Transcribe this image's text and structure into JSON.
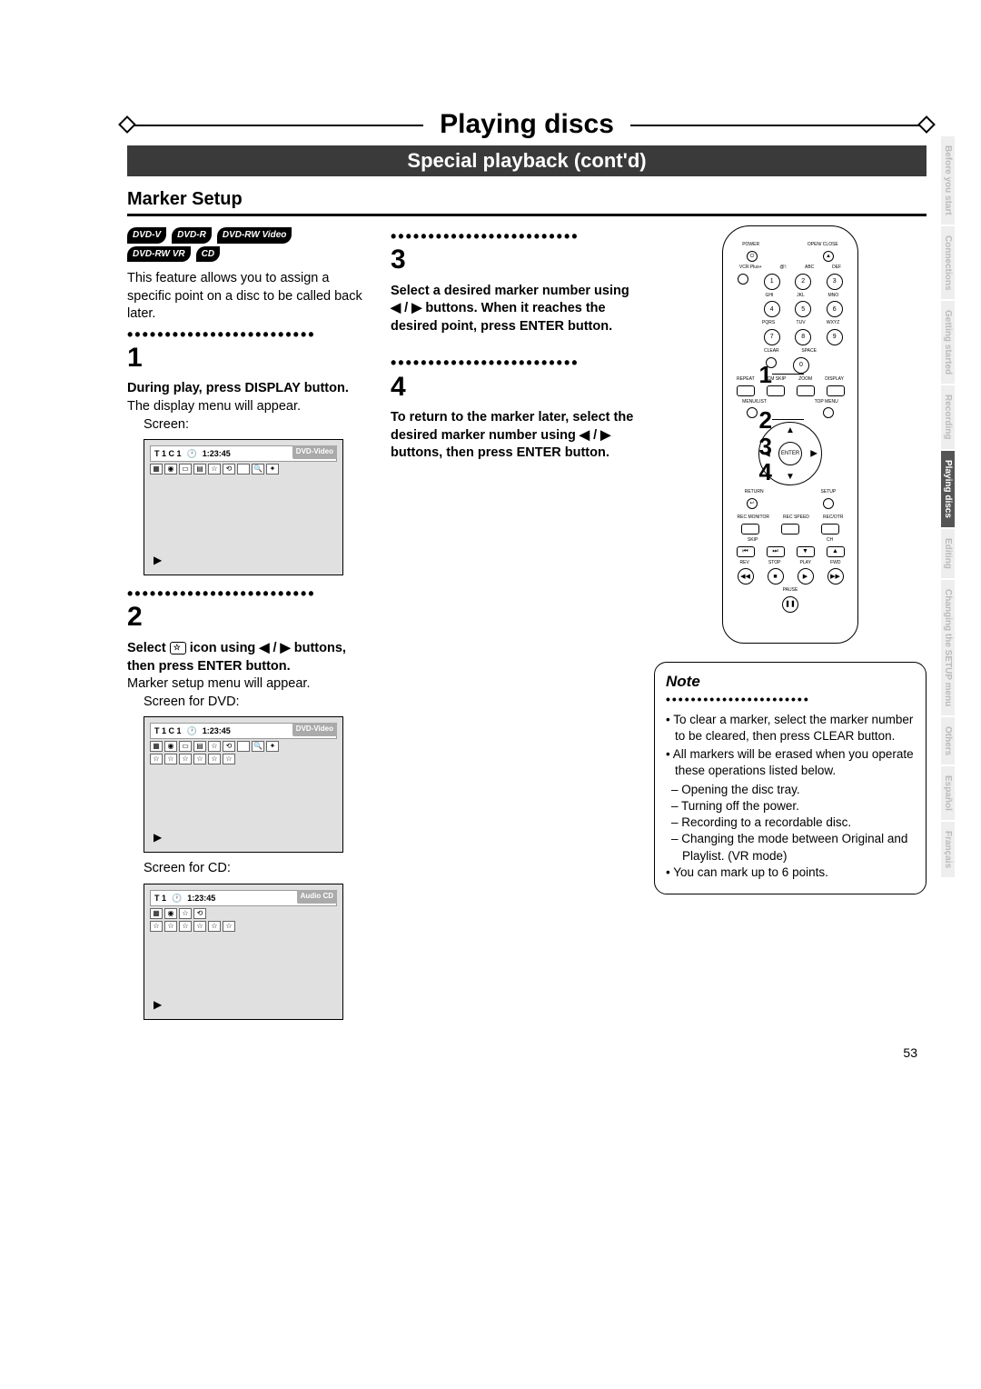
{
  "page_title": "Playing discs",
  "subtitle": "Special playback (cont'd)",
  "section_heading": "Marker Setup",
  "disc_badges": [
    "DVD-V",
    "DVD-R",
    "DVD-RW Video",
    "DVD-RW VR",
    "CD"
  ],
  "intro": "This feature allows you to assign a specific point on a disc to be called back later.",
  "step1": {
    "num": "1",
    "bold": "During play, press DISPLAY button.",
    "text": "The display menu will appear.",
    "screen_label": "Screen:",
    "screen_time": "1:23:45",
    "screen_info": "T   1  C   1",
    "disc_type": "DVD-Video"
  },
  "step2": {
    "num": "2",
    "bold_pre": "Select ",
    "bold_mid": " icon using ",
    "arrows": "◀ / ▶",
    "bold_post": " buttons, then press ENTER button.",
    "text": "Marker setup menu will appear.",
    "screen_dvd_label": "Screen for DVD:",
    "screen_dvd_info": "T   1  C   1",
    "screen_dvd_time": "1:23:45",
    "screen_dvd_type": "DVD-Video",
    "screen_cd_label": "Screen for CD:",
    "screen_cd_info": "T   1",
    "screen_cd_time": "1:23:45",
    "screen_cd_type": "Audio CD"
  },
  "step3": {
    "num": "3",
    "bold_a": "Select a desired marker number using ",
    "arrows": "◀ / ▶",
    "bold_b": " buttons. When it reaches the desired point, press ENTER button."
  },
  "step4": {
    "num": "4",
    "bold_a": "To return to the marker later, select the desired marker number using ",
    "arrows": "◀ / ▶",
    "bold_b": " buttons, then press ENTER button."
  },
  "callouts": [
    "1",
    "2",
    "3",
    "4"
  ],
  "remote": {
    "power": "POWER",
    "open": "OPEN/\nCLOSE",
    "vcr": "VCR Plus+",
    "n1": "1",
    "n2": "2",
    "n3": "3",
    "n4": "4",
    "n5": "5",
    "n6": "6",
    "n7": "7",
    "n8": "8",
    "n9": "9",
    "n0": "0",
    "l1": "@!:",
    "l2": "ABC",
    "l3": "DEF",
    "l4": "GHI",
    "l5": "JKL",
    "l6": "MNO",
    "l7": "PQRS",
    "l8": "TUV",
    "l9": "WXYZ",
    "clear": "CLEAR",
    "space": "SPACE",
    "repeat": "REPEAT",
    "cmskip": "CM SKIP",
    "zoom": "ZOOM",
    "display": "DISPLAY",
    "menu": "MENU/LIST",
    "top": "TOP MENU",
    "enter": "ENTER",
    "return": "RETURN",
    "setup": "SETUP",
    "recmon": "REC\nMONITOR",
    "recspd": "REC\nSPEED",
    "recotr": "REC/OTR",
    "skip": "SKIP",
    "ch": "CH",
    "stop": "STOP",
    "play": "PLAY",
    "rev": "REV",
    "fwd": "FWD",
    "pause": "PAUSE"
  },
  "note": {
    "title": "Note",
    "items": [
      "To clear a marker, select the marker number to be cleared, then press CLEAR button.",
      "All markers will be erased when you operate these operations listed below."
    ],
    "sub": [
      "Opening the disc tray.",
      "Turning off the power.",
      "Recording to a recordable disc.",
      "Changing the mode between Original and Playlist. (VR mode)"
    ],
    "last": "You can mark up to 6 points."
  },
  "side_tabs": [
    "Before you start",
    "Connections",
    "Getting started",
    "Recording",
    "Playing discs",
    "Editing",
    "Changing the SETUP menu",
    "Others",
    "Español",
    "Français"
  ],
  "active_tab": "Playing discs",
  "page_number": "53"
}
